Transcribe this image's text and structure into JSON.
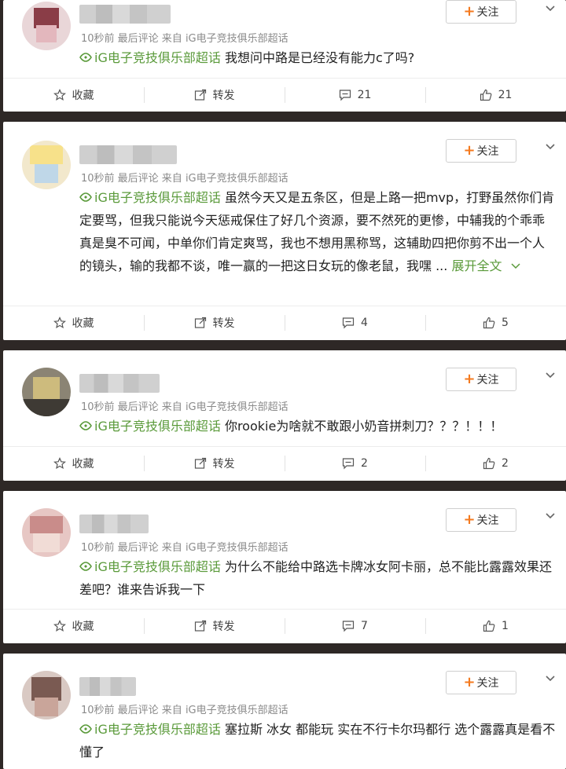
{
  "posts": [
    {
      "meta": "10秒前 最后评论 来自 iG电子竞技俱乐部超话",
      "follow_label": "关注",
      "topic": "iG电子竞技俱乐部超话",
      "text": "我想问中路是已经没有能力c了吗?",
      "expand_label": "",
      "actions": {
        "favorite": "收藏",
        "repost": "转发",
        "comments": "21",
        "likes": "21"
      }
    },
    {
      "meta": "10秒前 最后评论 来自 iG电子竞技俱乐部超话",
      "follow_label": "关注",
      "topic": "iG电子竞技俱乐部超话",
      "text": "虽然今天又是五条区，但是上路一把mvp，打野虽然你们肯定要骂，但我只能说今天惩戒保住了好几个资源，要不然死的更惨，中辅我的个乖乖真是臭不可闻，中单你们肯定爽骂，我也不想用黑称骂，这辅助四把你剪不出一个人的镜头，输的我都不谈，唯一赢的一把这日女玩的像老鼠，我嘿 ...",
      "expand_label": "展开全文",
      "actions": {
        "favorite": "收藏",
        "repost": "转发",
        "comments": "4",
        "likes": "5"
      }
    },
    {
      "meta": "10秒前 最后评论 来自 iG电子竞技俱乐部超话",
      "follow_label": "关注",
      "topic": "iG电子竞技俱乐部超话",
      "text": "你rookie为啥就不敢跟小奶音拼刺刀？？？！！！",
      "expand_label": "",
      "actions": {
        "favorite": "收藏",
        "repost": "转发",
        "comments": "2",
        "likes": "2"
      }
    },
    {
      "meta": "10秒前 最后评论 来自 iG电子竞技俱乐部超话",
      "follow_label": "关注",
      "topic": "iG电子竞技俱乐部超话",
      "text": "为什么不能给中路选卡牌冰女阿卡丽，总不能比露露效果还差吧？谁来告诉我一下",
      "expand_label": "",
      "actions": {
        "favorite": "收藏",
        "repost": "转发",
        "comments": "7",
        "likes": "1"
      }
    },
    {
      "meta": "10秒前 最后评论 来自 iG电子竞技俱乐部超话",
      "follow_label": "关注",
      "topic": "iG电子竞技俱乐部超话",
      "text": "塞拉斯 冰女 都能玩 实在不行卡尔玛都行 选个露露真是看不懂了",
      "expand_label": "",
      "actions": null
    }
  ],
  "colors": {
    "accent_green": "#5a9a3a",
    "follow_plus": "#f47a1f"
  },
  "icons": [
    "star-icon",
    "repost-icon",
    "comment-icon",
    "like-icon",
    "chevron-down-icon",
    "supertopic-icon"
  ]
}
